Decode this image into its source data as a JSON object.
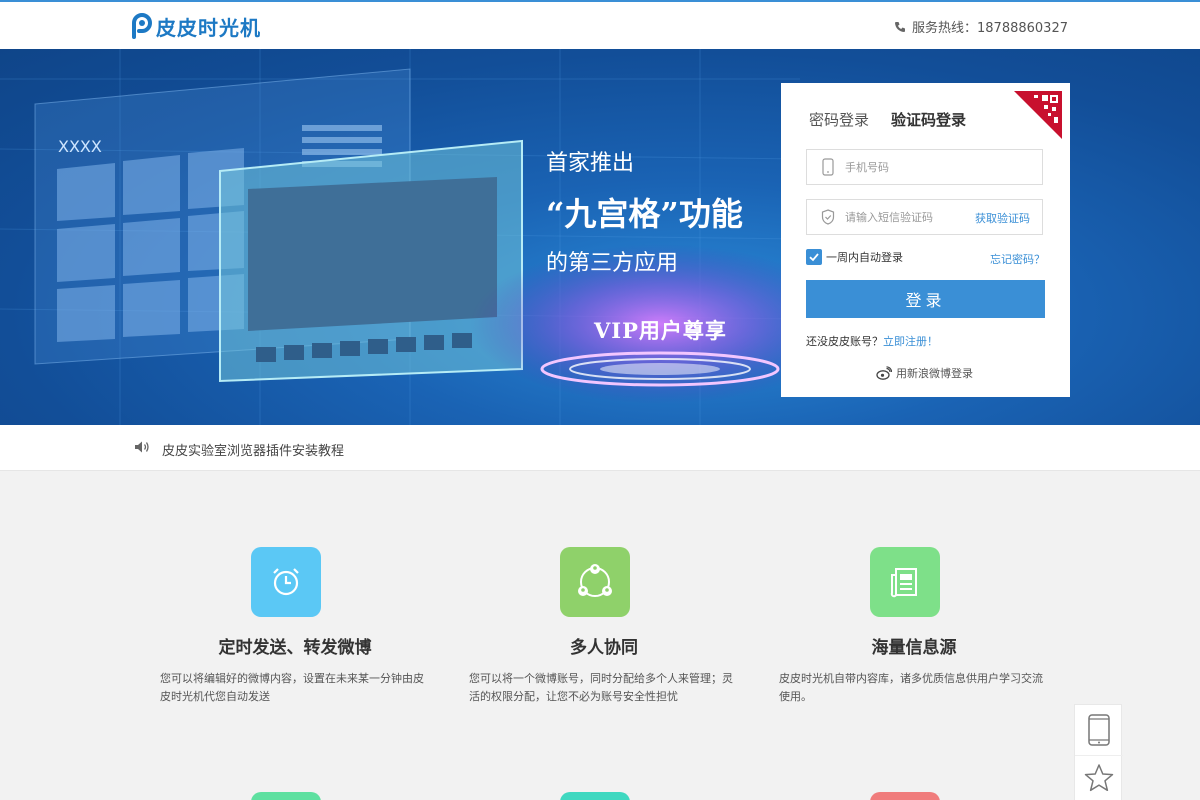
{
  "header": {
    "logo_text": "皮皮时光机",
    "hotline_label": "服务热线：18788860327"
  },
  "banner": {
    "screen_label": "XXXX",
    "line1": "首家推出",
    "line2": "“九宫格”功能",
    "line3": "的第三方应用",
    "vip": "VIP用户尊享"
  },
  "login": {
    "tab_password": "密码登录",
    "tab_sms": "验证码登录",
    "phone_placeholder": "手机号码",
    "code_placeholder": "请输入短信验证码",
    "get_code": "获取验证码",
    "remember": "一周内自动登录",
    "forgot": "忘记密码？",
    "submit": "登录",
    "no_account": "还没皮皮账号？",
    "register": "立即注册！",
    "weibo_login": "用新浪微博登录"
  },
  "notice": {
    "text": "皮皮实验室浏览器插件安装教程"
  },
  "features": [
    {
      "title": "定时发送、转发微博",
      "desc": "您可以将编辑好的微博内容，设置在未来某一分钟由皮皮时光机代您自动发送",
      "color": "#5bc8f5",
      "icon": "alarm-clock-icon"
    },
    {
      "title": "多人协同",
      "desc": "您可以将一个微博账号，同时分配给多个人来管理；灵活的权限分配，让您不必为账号安全性担忧",
      "color": "#8fd16a",
      "icon": "team-icon"
    },
    {
      "title": "海量信息源",
      "desc": "皮皮时光机自带内容库，诸多优质信息供用户学习交流使用。",
      "color": "#7ee089",
      "icon": "newspaper-icon"
    }
  ],
  "colors": {
    "accent": "#3a8fd6",
    "banner_bg": "#124e98"
  }
}
